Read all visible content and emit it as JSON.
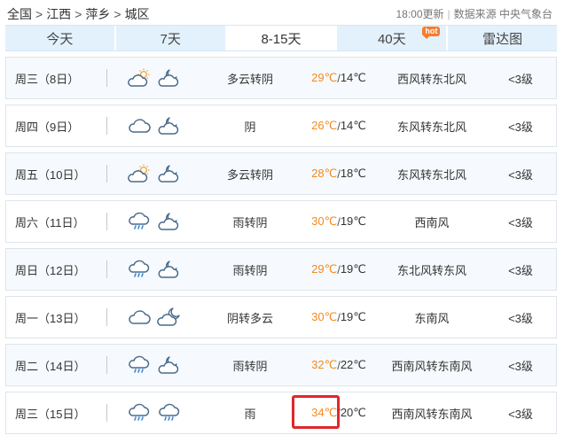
{
  "breadcrumb": [
    "全国",
    "江西",
    "萍乡",
    "城区"
  ],
  "meta": {
    "updated": "18:00更新",
    "source": "数据来源 中央气象台"
  },
  "tabs": [
    {
      "label": "今天",
      "active": false,
      "badge": ""
    },
    {
      "label": "7天",
      "active": false,
      "badge": ""
    },
    {
      "label": "8-15天",
      "active": true,
      "badge": ""
    },
    {
      "label": "40天",
      "active": false,
      "badge": "hot"
    },
    {
      "label": "雷达图",
      "active": false,
      "badge": ""
    }
  ],
  "colors": {
    "high_temp": "#f4891f",
    "highlight": "#e0272c",
    "tab_bg": "#e3f1fc"
  },
  "forecast": [
    {
      "day": "周三（8日）",
      "icon1": "partly-cloudy-icon",
      "icon2": "cloudy-night-icon",
      "desc": "多云转阴",
      "high": "29℃",
      "low": "14℃",
      "wind": "西风转东北风",
      "level": "<3级"
    },
    {
      "day": "周四（9日）",
      "icon1": "cloud-icon",
      "icon2": "cloudy-night-icon",
      "desc": "阴",
      "high": "26℃",
      "low": "14℃",
      "wind": "东风转东北风",
      "level": "<3级"
    },
    {
      "day": "周五（10日）",
      "icon1": "partly-cloudy-icon",
      "icon2": "cloudy-night-icon",
      "desc": "多云转阴",
      "high": "28℃",
      "low": "18℃",
      "wind": "东风转东北风",
      "level": "<3级"
    },
    {
      "day": "周六（11日）",
      "icon1": "rain-icon",
      "icon2": "cloudy-night-icon",
      "desc": "雨转阴",
      "high": "30℃",
      "low": "19℃",
      "wind": "西南风",
      "level": "<3级"
    },
    {
      "day": "周日（12日）",
      "icon1": "rain-icon",
      "icon2": "cloudy-night-icon",
      "desc": "雨转阴",
      "high": "29℃",
      "low": "19℃",
      "wind": "东北风转东风",
      "level": "<3级"
    },
    {
      "day": "周一（13日）",
      "icon1": "cloud-icon",
      "icon2": "moon-cloud-icon",
      "desc": "阴转多云",
      "high": "30℃",
      "low": "19℃",
      "wind": "东南风",
      "level": "<3级"
    },
    {
      "day": "周二（14日）",
      "icon1": "rain-icon",
      "icon2": "cloudy-night-icon",
      "desc": "雨转阴",
      "high": "32℃",
      "low": "22℃",
      "wind": "西南风转东南风",
      "level": "<3级"
    },
    {
      "day": "周三（15日）",
      "icon1": "rain-icon",
      "icon2": "rain-icon",
      "desc": "雨",
      "high": "34℃",
      "low": "20℃",
      "wind": "西南风转东南风",
      "level": "<3级",
      "highlighted": true
    }
  ]
}
